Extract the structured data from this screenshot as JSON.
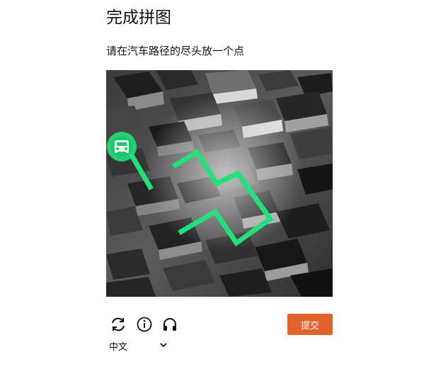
{
  "title": "完成拼图",
  "instruction": "请在汽车路径的尽头放一个点",
  "puzzle": {
    "image": "isometric-city-blocks",
    "path_color": "#22e07a",
    "start_icon": "car-icon"
  },
  "toolbar": {
    "refresh_icon": "refresh-icon",
    "info_icon": "info-icon",
    "audio_icon": "headphones-icon",
    "submit_label": "提交",
    "submit_color": "#e2622b"
  },
  "language": {
    "selected": "中文",
    "chevron_icon": "chevron-down-icon"
  }
}
